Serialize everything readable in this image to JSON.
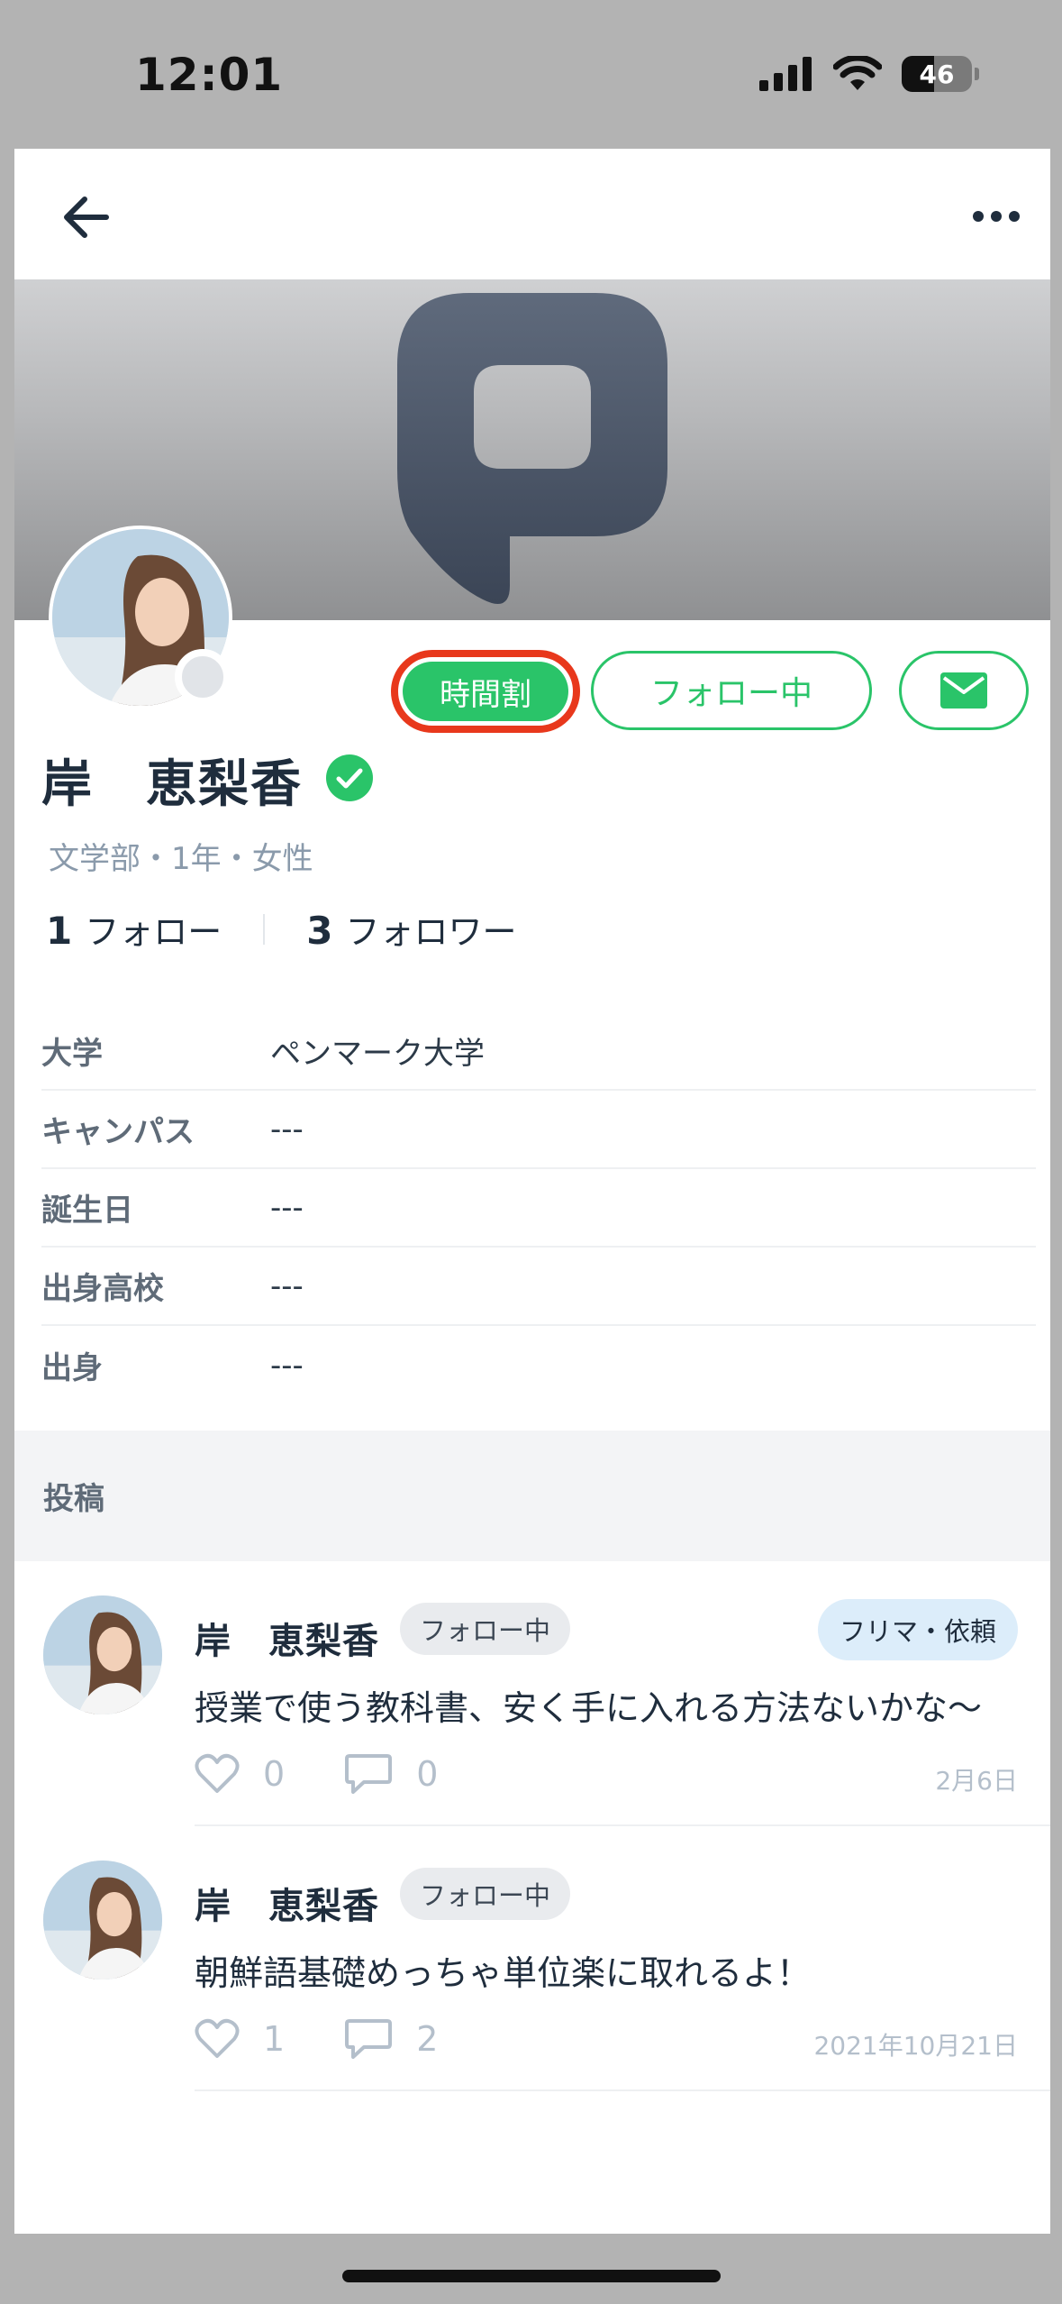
{
  "status_bar": {
    "time": "12:01",
    "battery": "46"
  },
  "nav": {
    "back_icon": "arrow-left-icon",
    "more_icon": "ellipsis-icon"
  },
  "profile": {
    "name": "岸　恵梨香",
    "meta": "文学部・1年・女性",
    "follow_count": "1",
    "follow_label": "フォロー",
    "follower_count": "3",
    "follower_label": "フォロワー"
  },
  "actions": {
    "timetable_label": "時間割",
    "following_label": "フォロー中",
    "mail_icon": "mail-icon"
  },
  "info": [
    {
      "label": "大学",
      "value": "ペンマーク大学"
    },
    {
      "label": "キャンパス",
      "value": "---"
    },
    {
      "label": "誕生日",
      "value": "---"
    },
    {
      "label": "出身高校",
      "value": "---"
    },
    {
      "label": "出身",
      "value": "---"
    }
  ],
  "posts_section": {
    "title": "投稿"
  },
  "posts": [
    {
      "author": "岸　恵梨香",
      "badge": "フォロー中",
      "category": "フリマ・依頼",
      "text": "授業で使う教科書、安く手に入れる方法ないかな〜",
      "likes": "0",
      "comments": "0",
      "date": "2月6日"
    },
    {
      "author": "岸　恵梨香",
      "badge": "フォロー中",
      "text": "朝鮮語基礎めっちゃ単位楽に取れるよ！",
      "likes": "1",
      "comments": "2",
      "date": "2021年10月21日"
    }
  ],
  "colors": {
    "accent": "#2ac469",
    "highlight": "#e8381c",
    "background": "#b3b3b3"
  }
}
